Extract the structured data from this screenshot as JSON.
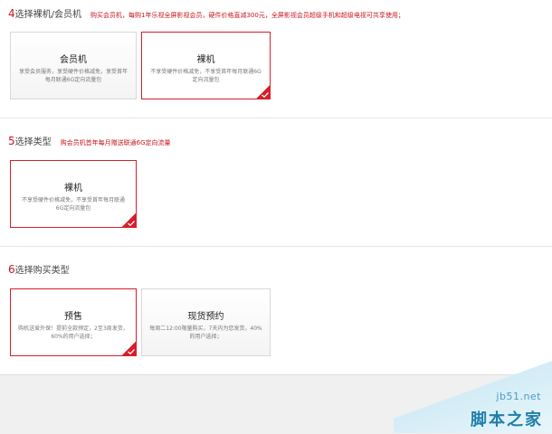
{
  "colors": {
    "accent": "#c8161d",
    "border": "#d8d8d8",
    "watermark": "#1f7fa9"
  },
  "section4": {
    "number": "4",
    "title": "选择裸机/会员机",
    "note": "购买会员机，每购1年乐视全屏影视会员，硬件价格直减300元，全屏影视会员超级手机和超级电视可共享使用；",
    "options": [
      {
        "title": "会员机",
        "desc": "享受会员服务，享受硬件价格减免，享受首年每月联通6G定向流量包",
        "selected": false
      },
      {
        "title": "裸机",
        "desc": "不享受硬件价格减免，不享受首年每月联通6G定向流量包",
        "selected": true
      }
    ]
  },
  "section5": {
    "number": "5",
    "title": "选择类型",
    "note": "购会员机首年每月赠送联通6G定向流量",
    "options": [
      {
        "title": "裸机",
        "desc": "不享受硬件价格减免，不享受首年每月联通6G定向流量包",
        "selected": true
      }
    ]
  },
  "section6": {
    "number": "6",
    "title": "选择购买类型",
    "options": [
      {
        "title": "预售",
        "desc": "购机送爱外保！提前全款预定，2至3周发货，60%的用户选择；",
        "selected": true
      },
      {
        "title": "现货预约",
        "desc": "每周二12:00限量购买，7天内为您发货，40%的用户选择；",
        "selected": false
      }
    ]
  },
  "watermark": {
    "domain": "jb51.net",
    "name": "脚本之家"
  }
}
